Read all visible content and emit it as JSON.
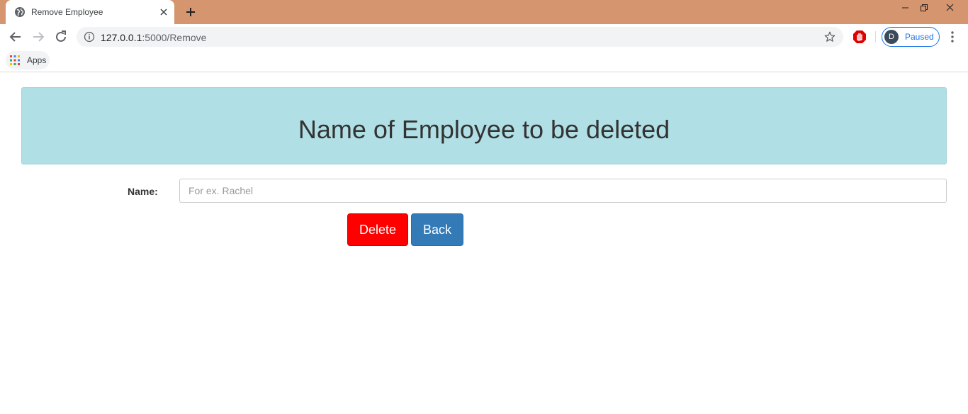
{
  "browser": {
    "tab": {
      "title": "Remove Employee",
      "favicon": "globe-icon",
      "close_icon": "close-icon"
    },
    "new_tab_icon": "plus-icon",
    "window_controls": [
      "minimize-icon",
      "restore-icon",
      "close-icon"
    ],
    "address_bar": {
      "host": "127.0.0.1",
      "path": ":5000/Remove",
      "info_icon": "info-icon",
      "bookmark_icon": "star-icon"
    },
    "extension_icon": "stop-hand-icon",
    "profile": {
      "initial": "D",
      "status": "Paused"
    },
    "menu_icon": "more-vert-icon",
    "bookmarks_bar": {
      "apps_label": "Apps",
      "apps_icon": "apps-grid-icon"
    },
    "colors": {
      "titlebar": "#d5956e",
      "accent": "#1a73e8"
    }
  },
  "page": {
    "heading": "Name of Employee to be deleted",
    "form": {
      "name_label": "Name:",
      "name_placeholder": "For ex. Rachel",
      "name_value": ""
    },
    "buttons": {
      "delete": "Delete",
      "back": "Back"
    },
    "colors": {
      "jumbotron": "#b0dfe5",
      "delete_button": "#ff0000",
      "back_button": "#337ab7"
    }
  }
}
